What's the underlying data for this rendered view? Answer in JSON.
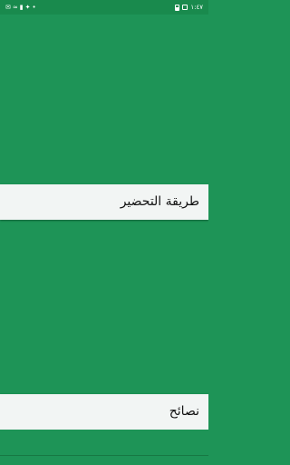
{
  "status_bar": {
    "icons_left": [
      "sms-icon",
      "wifi-icon",
      "signal-icon",
      "notification-icon",
      "dots-icon"
    ],
    "time": "١:٤٧"
  },
  "cards": [
    {
      "label": "طريقة التحضير"
    },
    {
      "label": "نصائح"
    }
  ],
  "colors": {
    "background": "#1e9457",
    "status_bar": "#198a4d",
    "label_bar": "#f2f5f4"
  }
}
